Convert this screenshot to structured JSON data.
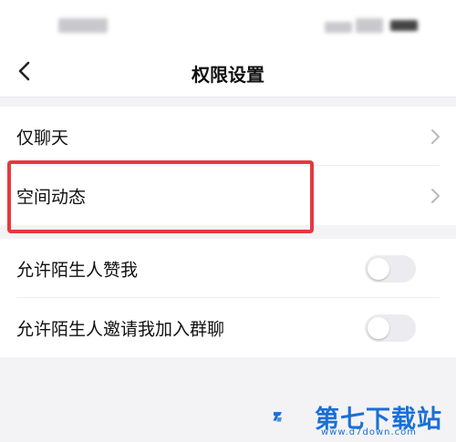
{
  "header": {
    "title": "权限设置"
  },
  "group1": [
    {
      "label": "仅聊天"
    },
    {
      "label": "空间动态"
    }
  ],
  "group2": [
    {
      "label": "允许陌生人赞我",
      "enabled": false
    },
    {
      "label": "允许陌生人邀请我加入群聊",
      "enabled": false
    }
  ],
  "watermark": {
    "name": "第七下载站",
    "url": "www.d7down.com"
  },
  "colors": {
    "highlight": "#e8373d",
    "brand": "#1a6fd6",
    "background": "#f3f3f6"
  }
}
